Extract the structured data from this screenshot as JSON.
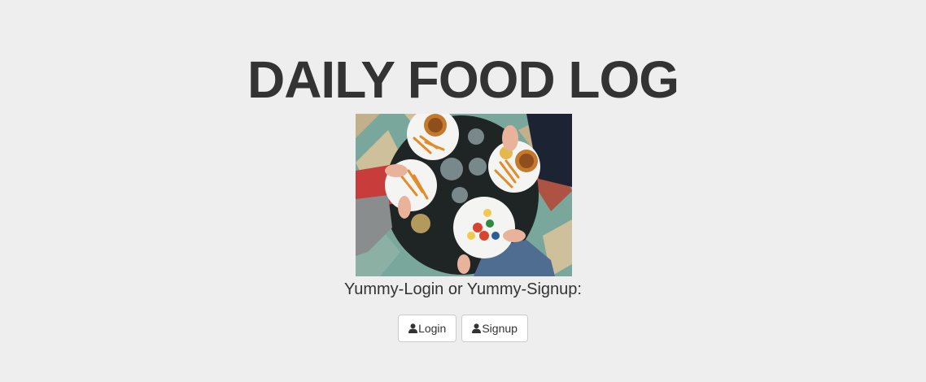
{
  "page": {
    "title": "DAILY FOOD LOG",
    "prompt": "Yummy-Login or Yummy-Signup:"
  },
  "buttons": {
    "login_label": "Login",
    "login_icon": "user-icon",
    "signup_label": "Signup",
    "signup_icon": "user-icon"
  },
  "colors": {
    "background": "#eeeeee",
    "text": "#333333",
    "button_border": "#cccccc"
  }
}
